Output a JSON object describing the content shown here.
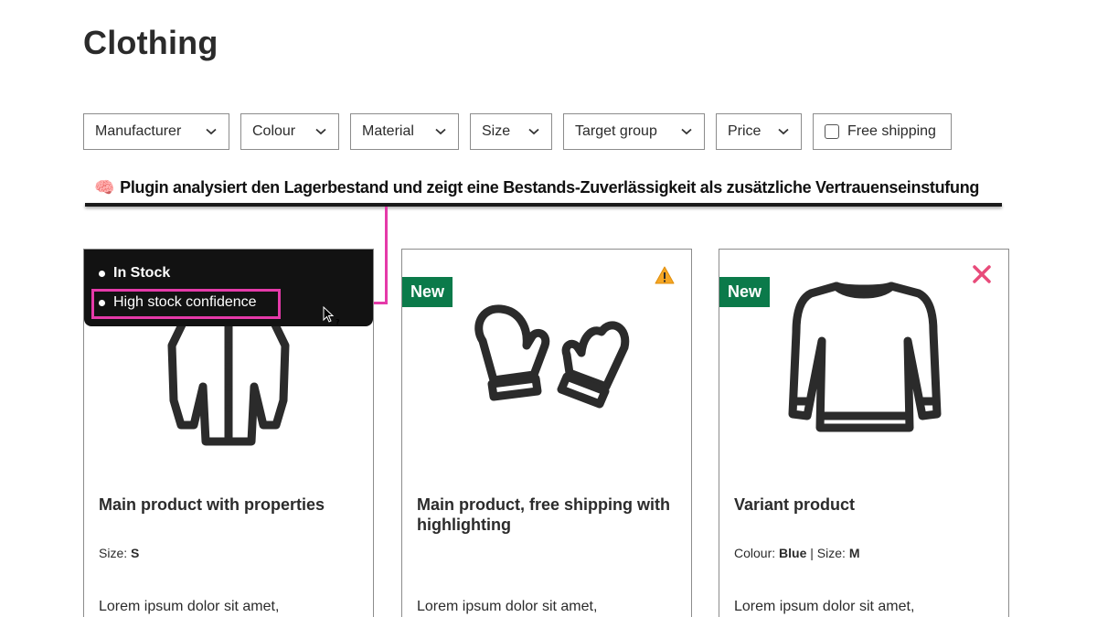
{
  "page": {
    "title": "Clothing"
  },
  "filters": {
    "manufacturer": "Manufacturer",
    "colour": "Colour",
    "material": "Material",
    "size": "Size",
    "target_group": "Target group",
    "price": "Price",
    "free_shipping": "Free shipping"
  },
  "annotation": {
    "icon": "brain-icon",
    "emoji": "🧠",
    "text": "Plugin analysiert den Lagerbestand und zeigt eine Bestands-Zuverlässigkeit als zusätzliche Vertrauenseinstufung",
    "highlight_color": "#e53aa9"
  },
  "tooltip": {
    "items": [
      "In Stock",
      "High stock confidence"
    ]
  },
  "products": [
    {
      "image_icon": "shirt-icon",
      "title": "Main product with properties",
      "props": [
        {
          "label": "Size:",
          "value": "S"
        }
      ],
      "description": "Lorem ipsum dolor sit amet,"
    },
    {
      "image_icon": "mittens-icon",
      "badge": "New",
      "status_icon": "warning-icon",
      "title": "Main product, free shipping with highlighting",
      "props": [],
      "description": "Lorem ipsum dolor sit amet,"
    },
    {
      "image_icon": "sweater-icon",
      "badge": "New",
      "status_icon": "close-icon",
      "title": "Variant product",
      "props": [
        {
          "label": "Colour:",
          "value": "Blue"
        },
        {
          "label": "Size:",
          "value": "M"
        }
      ],
      "separator": "|",
      "description": "Lorem ipsum dolor sit amet,"
    }
  ],
  "colors": {
    "badge_new": "#0b7a4a",
    "highlight": "#e53aa9",
    "warning": "#f5a623",
    "close": "#e84b7a",
    "tooltip_bg": "#121212"
  }
}
